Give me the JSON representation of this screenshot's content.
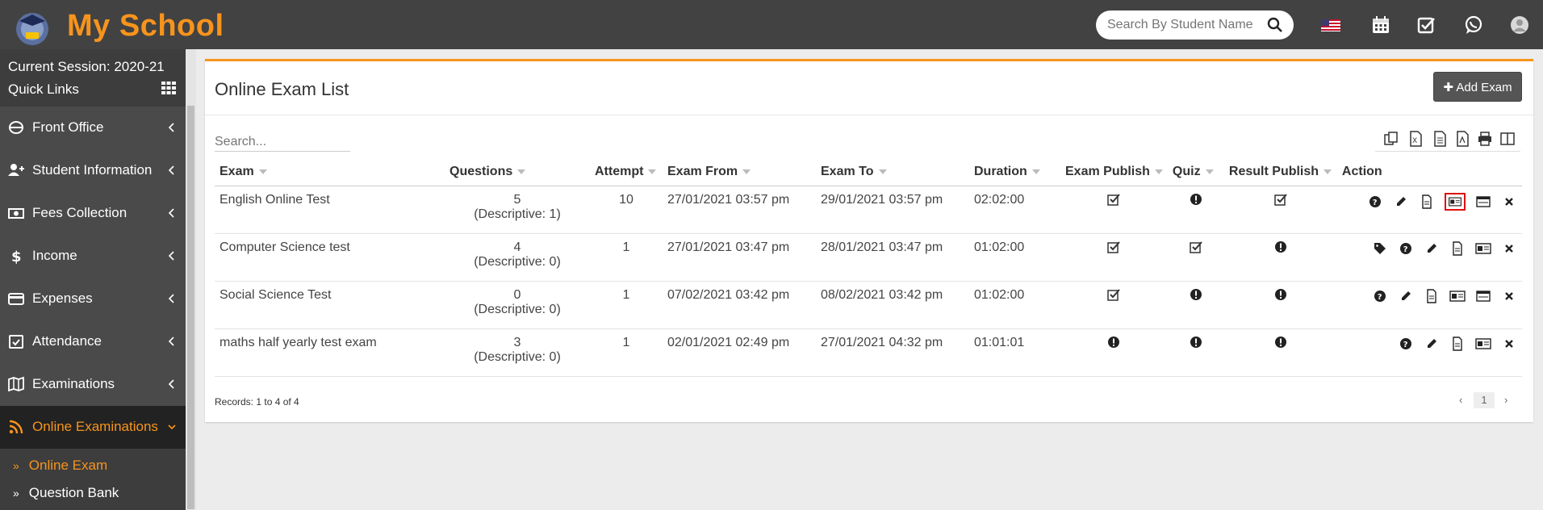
{
  "header": {
    "brand": "My School",
    "search_placeholder": "Search By Student Name",
    "icons": [
      "logo-icon",
      "flag-icon",
      "calendar-icon",
      "tasks-icon",
      "whatsapp-icon",
      "user-avatar-icon"
    ]
  },
  "sidebar": {
    "session": "Current Session: 2020-21",
    "quick_links": "Quick Links",
    "items": [
      {
        "label": "Front Office"
      },
      {
        "label": "Student Information"
      },
      {
        "label": "Fees Collection"
      },
      {
        "label": "Income"
      },
      {
        "label": "Expenses"
      },
      {
        "label": "Attendance"
      },
      {
        "label": "Examinations"
      },
      {
        "label": "Online Examinations"
      }
    ],
    "sub_items": [
      {
        "label": "Online Exam"
      },
      {
        "label": "Question Bank"
      }
    ]
  },
  "panel": {
    "title": "Online Exam List",
    "add_button": "Add Exam",
    "search_placeholder": "Search..."
  },
  "table": {
    "headers": [
      "Exam",
      "Questions",
      "Attempt",
      "Exam From",
      "Exam To",
      "Duration",
      "Exam Publish",
      "Quiz",
      "Result Publish",
      "Action"
    ],
    "rows": [
      {
        "exam": "English Online Test",
        "questions": "5",
        "descriptive": "(Descriptive: 1)",
        "attempt": "10",
        "from": "27/01/2021 03:57 pm",
        "to": "29/01/2021 03:57 pm",
        "duration": "02:02:00"
      },
      {
        "exam": "Computer Science test",
        "questions": "4",
        "descriptive": "(Descriptive: 0)",
        "attempt": "1",
        "from": "27/01/2021 03:47 pm",
        "to": "28/01/2021 03:47 pm",
        "duration": "01:02:00"
      },
      {
        "exam": "Social Science Test",
        "questions": "0",
        "descriptive": "(Descriptive: 0)",
        "attempt": "1",
        "from": "07/02/2021 03:42 pm",
        "to": "08/02/2021 03:42 pm",
        "duration": "01:02:00"
      },
      {
        "exam": "maths half yearly test exam",
        "questions": "3",
        "descriptive": "(Descriptive: 0)",
        "attempt": "1",
        "from": "02/01/2021 02:49 pm",
        "to": "27/01/2021 04:32 pm",
        "duration": "01:01:01"
      }
    ]
  },
  "footer": {
    "records": "Records: 1 to 4 of 4",
    "page": "1"
  },
  "colors": {
    "accent": "#f7941d",
    "topbar": "#424242",
    "sidebar": "#3d3d3d",
    "highlight": "#e01010"
  }
}
